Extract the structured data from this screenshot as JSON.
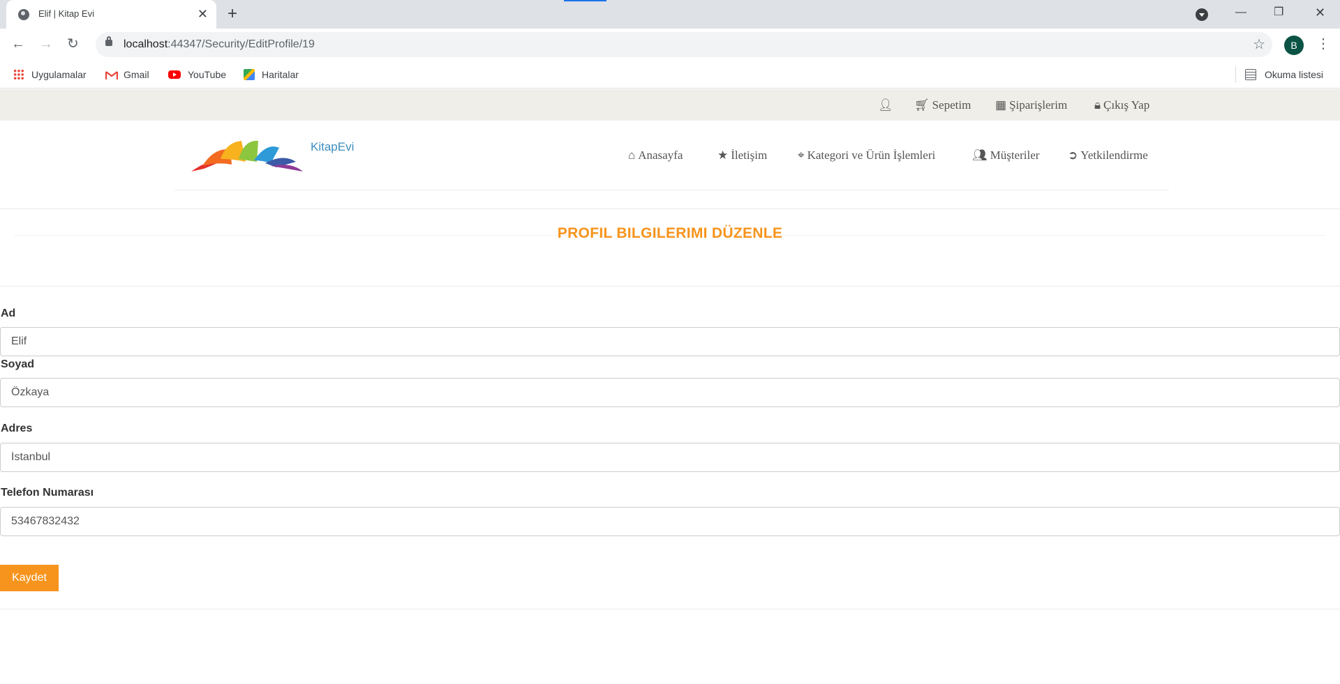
{
  "browser": {
    "tab_title": "Elif | Kitap Evi",
    "tab_close": "✕",
    "new_tab": "+",
    "url_host": "localhost",
    "url_path": ":44347/Security/EditProfile/19",
    "profile_initial": "B",
    "bookmarks": [
      {
        "label": "Uygulamalar",
        "icon": "apps-grid-icon"
      },
      {
        "label": "Gmail",
        "icon": "gmail-icon"
      },
      {
        "label": "YouTube",
        "icon": "youtube-icon"
      },
      {
        "label": "Haritalar",
        "icon": "maps-icon"
      }
    ],
    "reading_list": "Okuma listesi"
  },
  "topbar": {
    "user_icon": "user-icon",
    "cart": "Sepetim",
    "orders": "Şiparişlerim",
    "logout": "Çıkış Yap"
  },
  "header": {
    "brand": "KitapEvi",
    "nav": [
      {
        "label": "Anasayfa",
        "icon": "home-icon"
      },
      {
        "label": "İletişim",
        "icon": "star-icon"
      },
      {
        "label": "Kategori ve Ürün İşlemleri",
        "icon": "crosshairs-icon"
      },
      {
        "label": "Müşteriler",
        "icon": "users-icon"
      },
      {
        "label": "Yetkilendirme",
        "icon": "circle-arrow-icon"
      }
    ]
  },
  "form": {
    "title": "PROFIL BILGILERIMI DÜZENLE",
    "first_name_label": "Ad",
    "first_name_value": "Elif",
    "last_name_label": "Soyad",
    "last_name_value": "Özkaya",
    "address_label": "Adres",
    "address_value": "İstanbul",
    "phone_label": "Telefon Numarası",
    "phone_value": "53467832432",
    "save_label": "Kaydet"
  },
  "colors": {
    "accent": "#f7941d",
    "brand": "#3b8dbd",
    "topbar_bg": "#efeee8"
  }
}
